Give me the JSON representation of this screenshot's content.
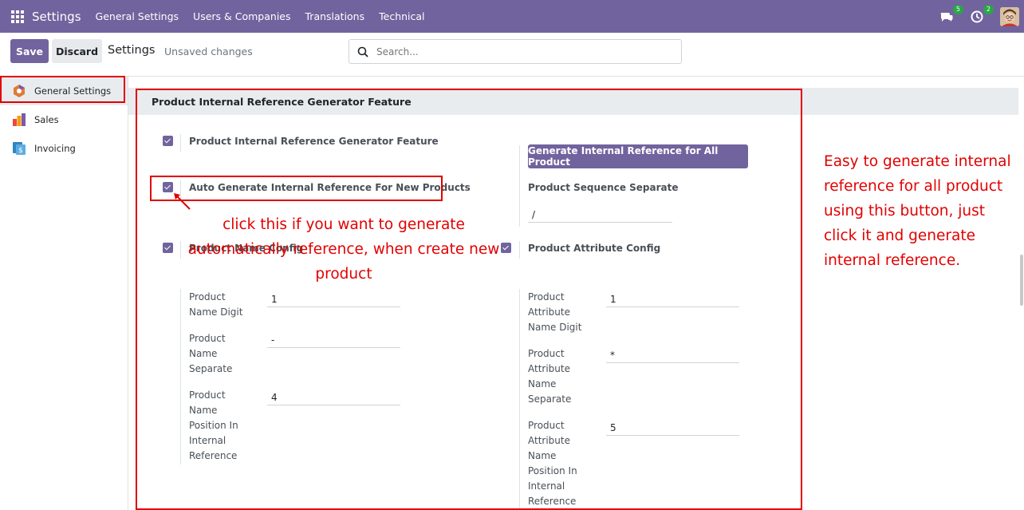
{
  "navbar": {
    "app_title": "Settings",
    "menus": [
      "General Settings",
      "Users & Companies",
      "Translations",
      "Technical"
    ],
    "messages_badge": "5",
    "activities_badge": "2"
  },
  "control": {
    "save_label": "Save",
    "discard_label": "Discard",
    "breadcrumb": "Settings",
    "unsaved": "Unsaved changes",
    "search_placeholder": "Search..."
  },
  "sidebar": {
    "items": [
      {
        "label": "General Settings",
        "icon": "settings-app-icon"
      },
      {
        "label": "Sales",
        "icon": "sales-app-icon"
      },
      {
        "label": "Invoicing",
        "icon": "invoicing-app-icon"
      }
    ]
  },
  "section": {
    "title": "Product Internal Reference Generator Feature",
    "feature_label": "Product Internal Reference Generator Feature",
    "generate_button": "Generate Internal Reference for All Product",
    "auto_label": "Auto Generate Internal Reference For New Products",
    "sequence_label": "Product Sequence Separate",
    "sequence_value": "/",
    "name_config_label": "Product Name Config",
    "attribute_config_label": "Product Attribute Config",
    "name_digit_label": "Product Name Digit",
    "name_digit_value": "1",
    "name_separate_label": "Product Name Separate",
    "name_separate_value": "-",
    "name_position_label": "Product Name Position In Internal Reference",
    "name_position_value": "4",
    "attr_digit_label": "Product Attribute Name Digit",
    "attr_digit_value": "1",
    "attr_separate_label": "Product Attribute Name Separate",
    "attr_separate_value": "*",
    "attr_position_label": "Product Attribute Name Position In Internal Reference",
    "attr_position_value": "5"
  },
  "annotations": {
    "auto_note": "click this if you want to generate automatically reference, when create new product",
    "button_note": "Easy to generate internal reference for all product using this button, just click it and generate internal reference."
  },
  "colors": {
    "brand": "#71639e",
    "annotation": "#e30000"
  }
}
